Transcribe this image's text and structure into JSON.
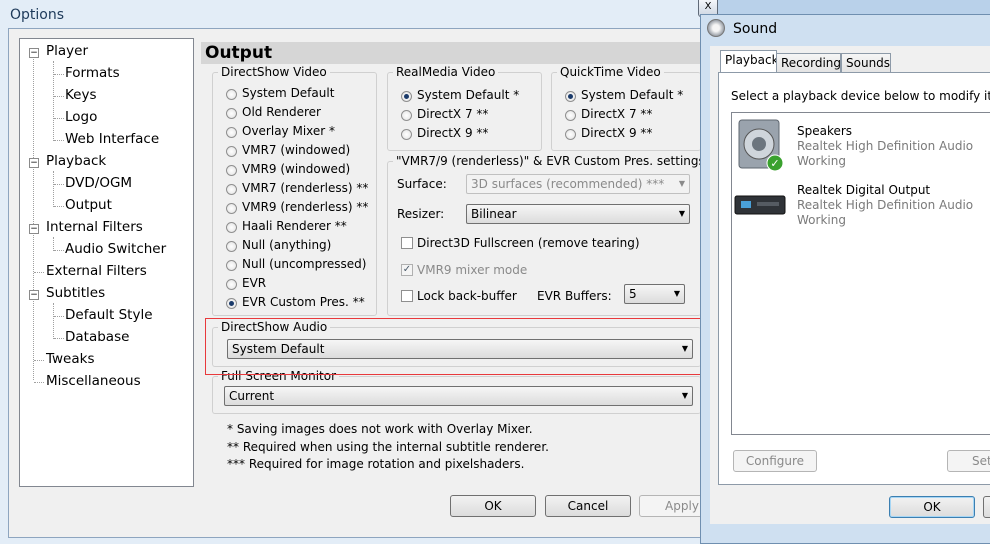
{
  "options_window": {
    "title": "Options",
    "close_label": "X",
    "tree": [
      {
        "label": "Player",
        "expander": "−"
      },
      {
        "label": "Formats"
      },
      {
        "label": "Keys"
      },
      {
        "label": "Logo"
      },
      {
        "label": "Web Interface"
      },
      {
        "label": "Playback",
        "expander": "−"
      },
      {
        "label": "DVD/OGM"
      },
      {
        "label": "Output"
      },
      {
        "label": "Internal Filters",
        "expander": "−"
      },
      {
        "label": "Audio Switcher"
      },
      {
        "label": "External Filters"
      },
      {
        "label": "Subtitles",
        "expander": "−"
      },
      {
        "label": "Default Style"
      },
      {
        "label": "Database"
      },
      {
        "label": "Tweaks"
      },
      {
        "label": "Miscellaneous"
      }
    ],
    "page_title": "Output",
    "directshow_video": {
      "caption": "DirectShow Video",
      "options": [
        "System Default",
        "Old Renderer",
        "Overlay Mixer *",
        "VMR7 (windowed)",
        "VMR9 (windowed)",
        "VMR7 (renderless) **",
        "VMR9 (renderless) **",
        "Haali Renderer **",
        "Null (anything)",
        "Null (uncompressed)",
        "EVR",
        "EVR Custom Pres. **"
      ],
      "selected": "EVR Custom Pres. **"
    },
    "realmedia_video": {
      "caption": "RealMedia Video",
      "options": [
        "System Default *",
        "DirectX 7 **",
        "DirectX 9 **"
      ],
      "selected": "System Default *"
    },
    "quicktime_video": {
      "caption": "QuickTime Video",
      "options": [
        "System Default *",
        "DirectX 7 **",
        "DirectX 9 **"
      ],
      "selected": "System Default *"
    },
    "vmr_settings": {
      "caption": "\"VMR7/9 (renderless)\" & EVR Custom Pres. settings",
      "surface_label": "Surface:",
      "surface_value": "3D surfaces (recommended) ***",
      "resizer_label": "Resizer:",
      "resizer_value": "Bilinear",
      "d3d_fullscreen": "Direct3D Fullscreen (remove tearing)",
      "vmr9_mixer": "VMR9 mixer mode",
      "lock_backbuffer": "Lock back-buffer",
      "evr_buffers_label": "EVR Buffers:",
      "evr_buffers_value": "5",
      "check_mark": "✓"
    },
    "directshow_audio": {
      "caption": "DirectShow Audio",
      "value": "System Default"
    },
    "fullscreen_monitor": {
      "caption": "Full Screen Monitor",
      "value": "Current"
    },
    "notes": [
      "* Saving images does not work with Overlay Mixer.",
      "** Required when using the internal subtitle renderer.",
      "*** Required for image rotation and pixelshaders."
    ],
    "buttons": {
      "ok": "OK",
      "cancel": "Cancel",
      "apply": "Apply"
    },
    "dropdown_arrow": "▼"
  },
  "sound_window": {
    "title": "Sound",
    "tabs": [
      "Playback",
      "Recording",
      "Sounds"
    ],
    "active_tab": "Playback",
    "instruction": "Select a playback device below to modify its setti",
    "devices": [
      {
        "name": "Speakers",
        "driver": "Realtek High Definition Audio",
        "status": "Working",
        "icon": "speaker-icon",
        "default": true
      },
      {
        "name": "Realtek Digital Output",
        "driver": "Realtek High Definition Audio",
        "status": "Working",
        "icon": "digital-output-icon",
        "default": false
      }
    ],
    "buttons": {
      "configure": "Configure",
      "set_default": "Set",
      "ok": "OK"
    },
    "default_badge": "✓"
  },
  "colors": {
    "highlight_border": "#e8393c",
    "window_frame": "#b9d1ea"
  }
}
